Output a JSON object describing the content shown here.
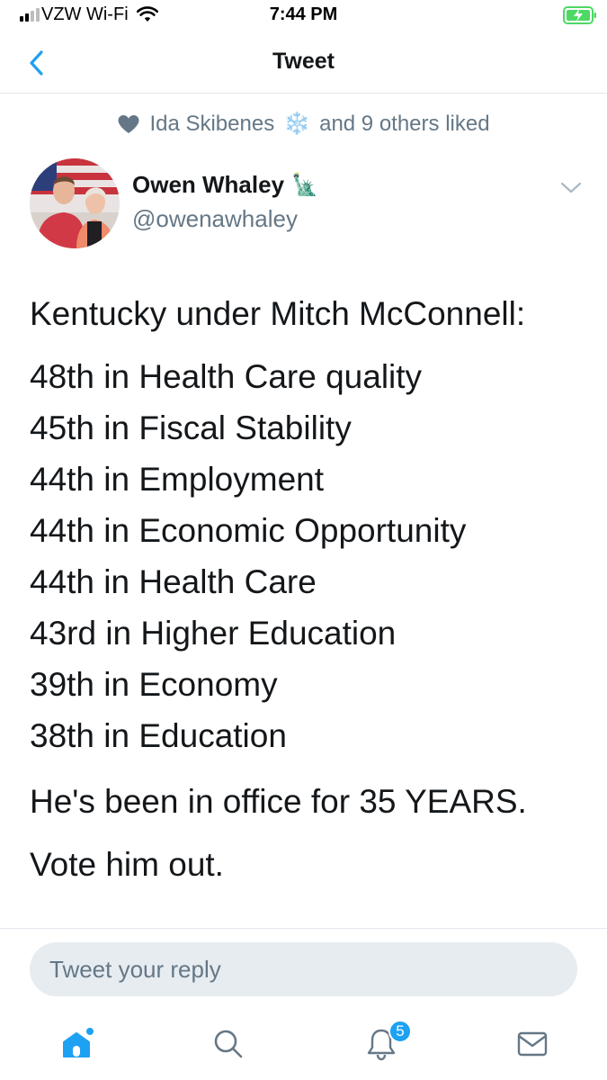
{
  "status_bar": {
    "carrier": "VZW Wi-Fi",
    "time": "7:44 PM",
    "signal_bars_active": 2,
    "signal_bars_total": 4,
    "battery_charging": true,
    "battery_color": "#4cd964"
  },
  "nav": {
    "title": "Tweet",
    "back_icon": "chevron-left-icon"
  },
  "social_context": {
    "liker_name": "Ida Skibenes",
    "liker_emoji": "❄️",
    "others_text": "and 9 others liked",
    "icon": "heart-icon"
  },
  "author": {
    "name": "Owen Whaley",
    "name_emoji": "🗽",
    "handle": "@owenawhaley",
    "avatar_icon": "profile-photo"
  },
  "tweet": {
    "intro": "Kentucky under Mitch McConnell:",
    "rankings": [
      "48th in Health Care quality",
      "45th in Fiscal Stability",
      "44th in Employment",
      "44th in Economic Opportunity",
      "44th in Health Care",
      "43rd in Higher Education",
      "39th in Economy",
      "38th in Education"
    ],
    "statement": "He's been in office for 35 YEARS.",
    "call_to_action": "Vote him out."
  },
  "reply": {
    "placeholder": "Tweet your reply"
  },
  "tab_bar": {
    "notifications_badge": "5",
    "tabs": [
      "home-icon",
      "search-icon",
      "notifications-icon",
      "messages-icon"
    ],
    "active_color": "#1da1f2",
    "inactive_color": "#657786"
  }
}
